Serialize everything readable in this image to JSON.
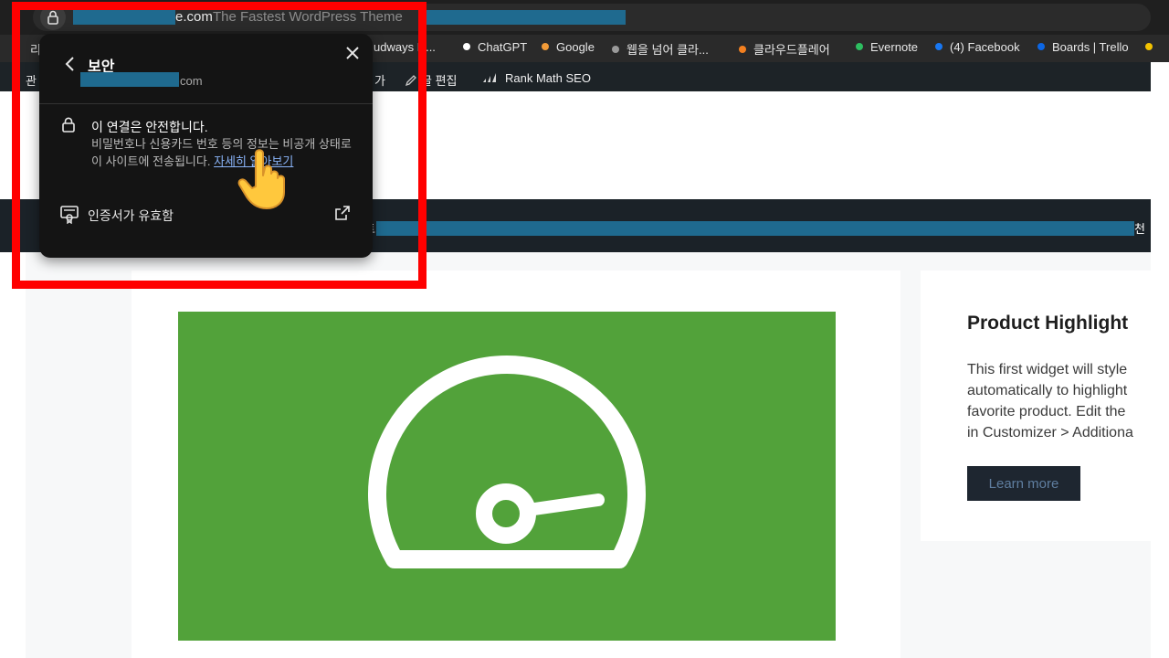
{
  "addressbar": {
    "domain_visible": "e.com",
    "tagline": "The Fastest WordPress Theme"
  },
  "bookmarks": [
    {
      "label": "udways N...",
      "color": ""
    },
    {
      "label": "ChatGPT",
      "color": "#ffffff"
    },
    {
      "label": "Google",
      "color": "#f29b38"
    },
    {
      "label": "웹을 넘어 클라...",
      "color": "#9a9a9a"
    },
    {
      "label": "클라우드플레어",
      "color": "#f38020"
    },
    {
      "label": "Evernote",
      "color": "#2dbe60"
    },
    {
      "label": "(4) Facebook",
      "color": "#1877f2"
    },
    {
      "label": "Boards | Trello",
      "color": "#0c66e4"
    }
  ],
  "left_edge_fragments": {
    "bookmarks": "리",
    "adminbar": "관"
  },
  "adminbar": {
    "fragment": "가",
    "edit_post": "글 편집",
    "seo": "Rank Math SEO"
  },
  "navbar": {
    "left_char": "트",
    "right_char": "천"
  },
  "widget": {
    "title": "Product Highlight",
    "lines": [
      "This first widget will style",
      "automatically to highlight",
      "favorite product. Edit the",
      "in Customizer > Additiona"
    ],
    "button_label": "Learn more"
  },
  "security_popup": {
    "title": "보안",
    "domain_suffix": "com",
    "connection_title": "이 연결은 안전합니다.",
    "connection_desc": "비밀번호나 신용카드 번호 등의 정보는 비공개 상태로 이 사이트에 전송됩니다.",
    "learn_more_link": "자세히 알아보기",
    "certificate_label": "인증서가 유효함"
  },
  "colors": {
    "highlight_frame": "#ff0000",
    "hero_green": "#52a23a",
    "redaction": "#1f6a8f",
    "link": "#8ab4f8"
  },
  "icons": [
    "lock-icon",
    "back-arrow-icon",
    "close-icon",
    "certificate-icon",
    "external-link-icon",
    "speedometer-icon",
    "pointing-hand-icon",
    "edit-pencil-icon",
    "rank-math-icon"
  ]
}
